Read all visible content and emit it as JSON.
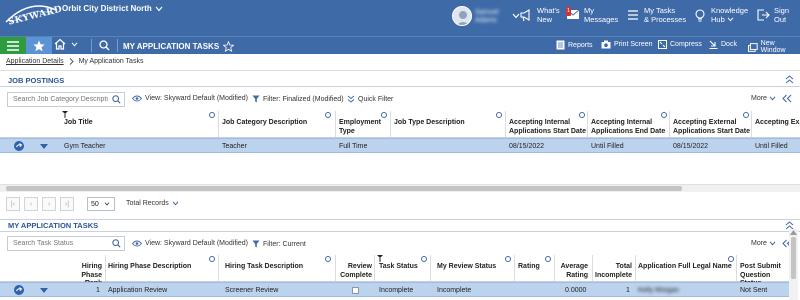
{
  "header": {
    "logo_text": "SKYWARD",
    "district": "Orbit City District North",
    "user_name_line1": "Samuel",
    "user_name_line2": "Adams",
    "whats_new": [
      "What's",
      "New"
    ],
    "messages": [
      "My",
      "Messages"
    ],
    "messages_badge": "1",
    "tasks": [
      "My Tasks",
      "& Processes"
    ],
    "knowledge": [
      "Knowledge",
      "Hub"
    ],
    "sign_out": [
      "Sign",
      "Out"
    ]
  },
  "nav": {
    "page_title": "MY APPLICATION TASKS",
    "tools": [
      "Reports",
      "Print Screen",
      "Compress",
      "Dock",
      "New Window"
    ]
  },
  "breadcrumb": {
    "link": "Application Details",
    "current": "My Application Tasks"
  },
  "job_postings": {
    "title": "JOB POSTINGS",
    "search_placeholder": "Search Job Category Descripti",
    "view_label": "View: Skyward Default (Modified)",
    "filter_label": "Filter: Finalized (Modified)",
    "quick_filter": "Quick Filter",
    "more": "More",
    "columns": [
      "Job Title",
      "Job Category Description",
      "Employment Type",
      "Job Type Description",
      "Accepting Internal Applications Start Date",
      "Accepting Internal Applications End Date",
      "Accepting External Applications Start Date",
      "Accepting Ex..."
    ],
    "rows": [
      [
        "Gym Teacher",
        "Teacher",
        "Full Time",
        "",
        "08/15/2022",
        "Until Filled",
        "08/15/2022",
        "Until Filled"
      ]
    ],
    "page_size": "50",
    "total_records": "Total Records"
  },
  "app_tasks": {
    "title": "MY APPLICATION TASKS",
    "search_placeholder": "Search Task Status",
    "view_label": "View: Skyward Default (Modified)",
    "filter_label": "Filter: Current",
    "more": "More",
    "columns": [
      "Hiring Phase Rank",
      "Hiring Phase Description",
      "Hiring Task Description",
      "Review Complete",
      "Task Status",
      "My Review Status",
      "Rating",
      "Average Rating",
      "Total Incomplete",
      "Application Full Legal Name",
      "Post Submit Question Status"
    ],
    "rows": [
      [
        "1",
        "Application Review",
        "Screener Review",
        "",
        "Incomplete",
        "Incomplete",
        "",
        "0.0000",
        "1",
        "Kelly Morgan",
        "Not Sent"
      ]
    ]
  },
  "colors": {
    "header_blue": "#3f6aa8",
    "nav_green": "#2e9b40",
    "row_highlight": "#bcd3ee",
    "section_title": "#2a5596"
  }
}
